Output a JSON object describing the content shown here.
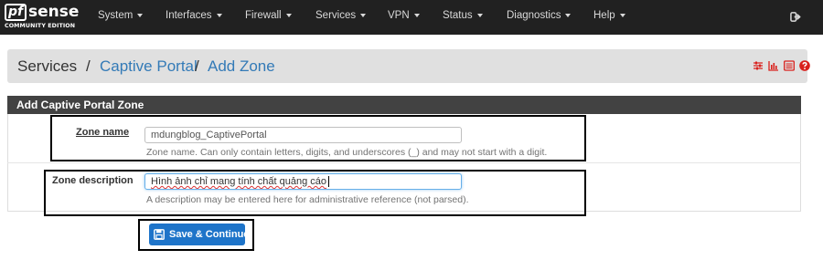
{
  "brand": {
    "logo_pf": "pf",
    "logo_sense": "sense",
    "edition": "COMMUNITY EDITION"
  },
  "nav": {
    "items": [
      {
        "label": "System"
      },
      {
        "label": "Interfaces"
      },
      {
        "label": "Firewall"
      },
      {
        "label": "Services"
      },
      {
        "label": "VPN"
      },
      {
        "label": "Status"
      },
      {
        "label": "Diagnostics"
      },
      {
        "label": "Help"
      }
    ],
    "logout_icon": "logout-icon"
  },
  "breadcrumb": {
    "items": [
      "Services",
      "Captive Portal",
      "Add Zone"
    ],
    "separator": "/",
    "icons": [
      "sliders-icon",
      "bar-chart-icon",
      "list-icon",
      "question-circle-icon"
    ],
    "icon_color": "#d9201c"
  },
  "panel": {
    "title": "Add Captive Portal Zone",
    "fields": [
      {
        "label": "Zone name",
        "value": "mdungblog_CaptivePortal",
        "help": "Zone name. Can only contain letters, digits, and underscores (_) and may not start with a digit."
      },
      {
        "label": "Zone description",
        "value": "Hình ảnh chỉ mang tính chất quảng cáo",
        "help": "A description may be entered here for administrative reference (not parsed)."
      }
    ]
  },
  "save_button": {
    "label": "Save & Continue",
    "icon": "save-icon"
  },
  "colors": {
    "navbar": "#212121",
    "link": "#337ab7",
    "button": "#1e74c9",
    "panel_head": "#424242"
  }
}
